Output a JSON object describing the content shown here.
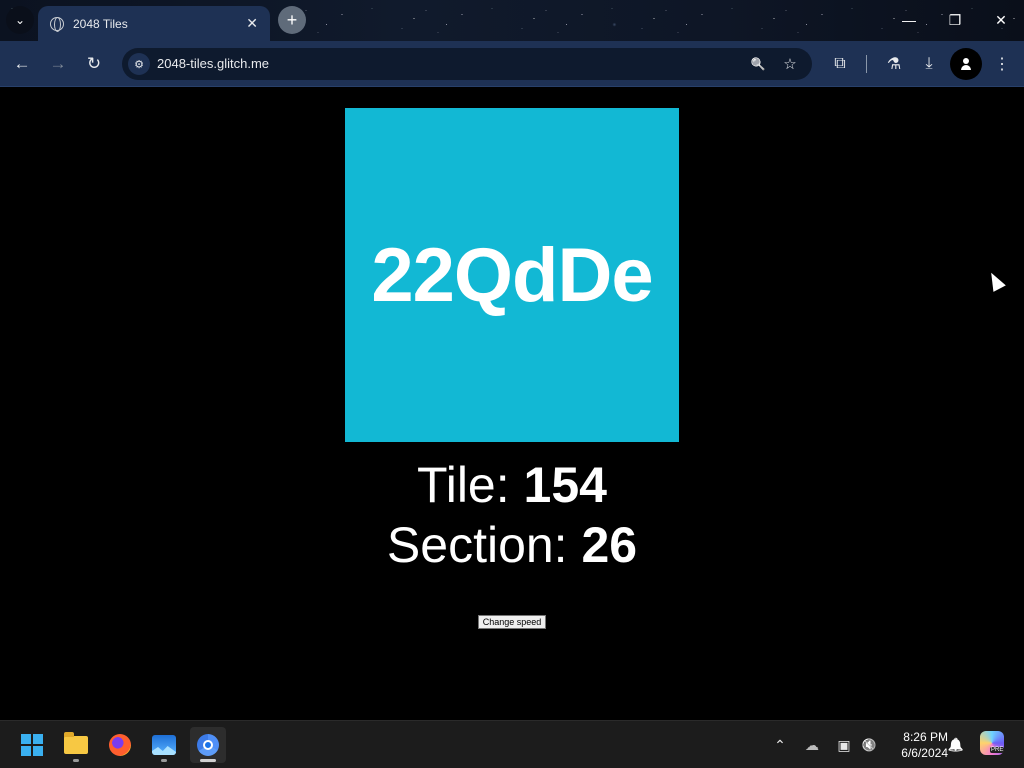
{
  "browser": {
    "tab": {
      "title": "2048 Tiles",
      "close_glyph": "✕"
    },
    "new_tab_glyph": "+",
    "tab_list_glyph": "⌄",
    "window_controls": {
      "minimize": "—",
      "restore": "❐",
      "close": "✕"
    },
    "nav": {
      "back": "←",
      "forward": "→",
      "reload": "↻"
    },
    "url": "2048-tiles.glitch.me",
    "site_info_glyph": "⚙",
    "omnibox_icons": {
      "zoom": "🔍",
      "bookmark": "☆"
    },
    "toolbar_icons": {
      "extensions": "⧉",
      "labs": "⚗",
      "download": "⤓",
      "menu": "⋮"
    }
  },
  "game": {
    "tile_text": "22QdDe",
    "tile_color": "#12b8d4",
    "tile_label": "Tile: ",
    "tile_number": "154",
    "section_label": "Section: ",
    "section_number": "26",
    "change_speed_label": "Change speed"
  },
  "taskbar": {
    "icons": [
      "start-icon",
      "file-explorer-icon",
      "firefox-icon",
      "photos-icon",
      "chrome-icon"
    ],
    "tray": {
      "chevron": "⌃",
      "cloud": "☁",
      "display": "▣",
      "volume": "🔇",
      "bell": "🔔"
    },
    "time": "8:26 PM",
    "date": "6/6/2024",
    "copilot_badge": "PRE"
  }
}
